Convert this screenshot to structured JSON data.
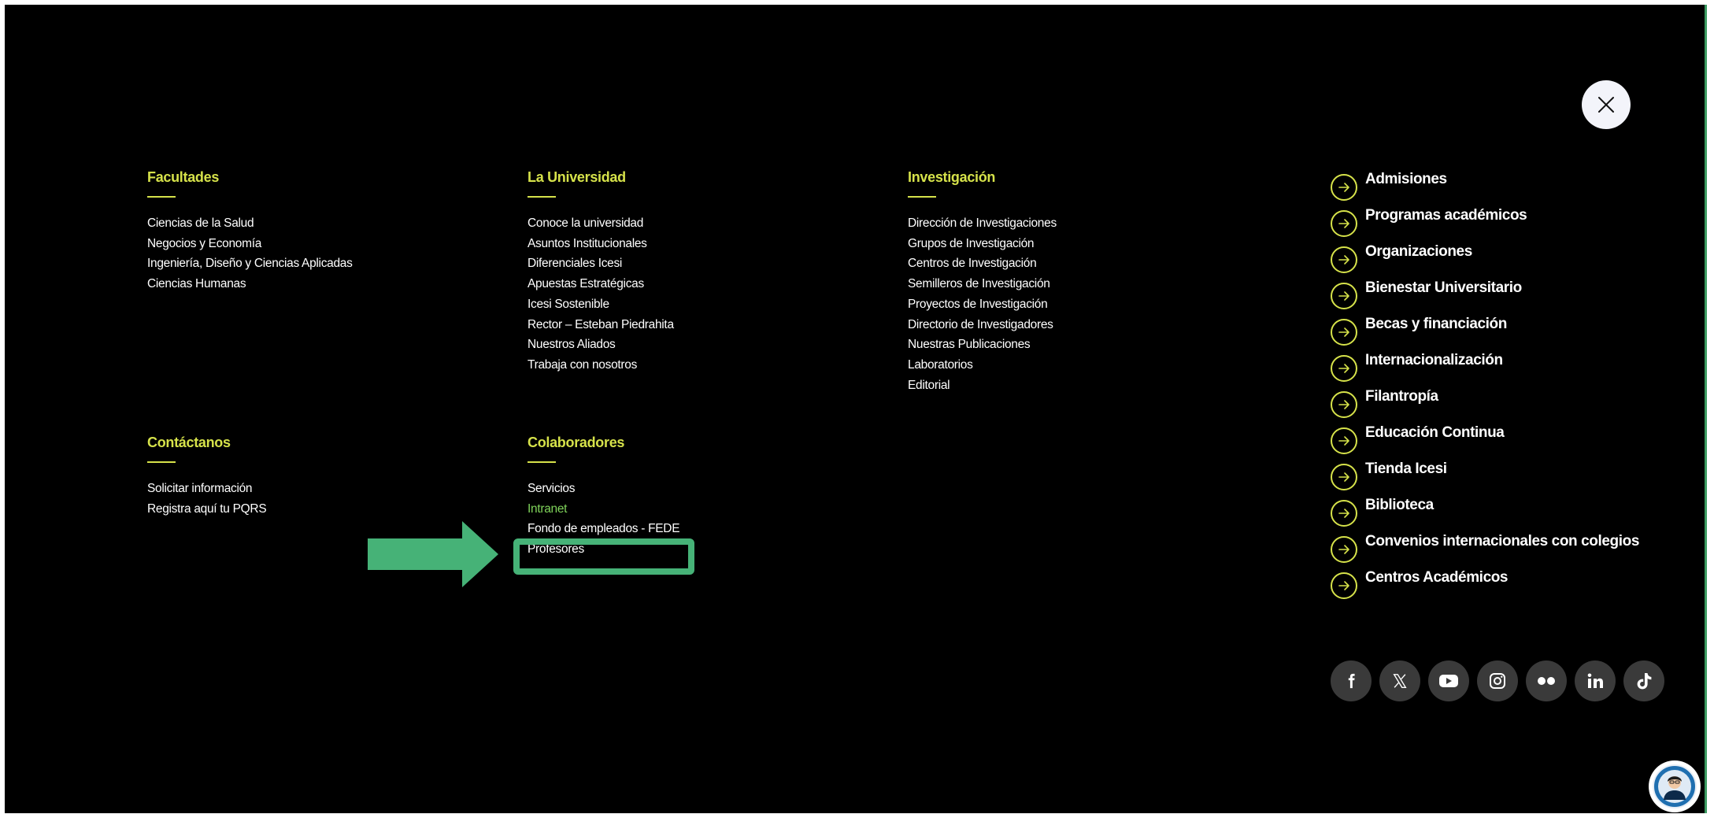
{
  "close": {
    "icon": "close-icon"
  },
  "sections": {
    "facultades": {
      "title": "Facultades",
      "items": [
        "Ciencias de la Salud",
        "Negocios y Economía",
        "Ingeniería, Diseño y Ciencias Aplicadas",
        "Ciencias Humanas"
      ]
    },
    "universidad": {
      "title": "La Universidad",
      "items": [
        "Conoce la universidad",
        "Asuntos Institucionales",
        "Diferenciales Icesi",
        "Apuestas Estratégicas",
        "Icesi Sostenible",
        "Rector – Esteban Piedrahita",
        "Nuestros Aliados",
        "Trabaja con nosotros"
      ]
    },
    "investigacion": {
      "title": "Investigación",
      "items": [
        "Dirección de Investigaciones",
        "Grupos de Investigación",
        "Centros de Investigación",
        "Semilleros de Investigación",
        "Proyectos de Investigación",
        "Directorio de Investigadores",
        "Nuestras Publicaciones",
        "Laboratorios",
        "Editorial"
      ]
    },
    "contactanos": {
      "title": "Contáctanos",
      "items": [
        "Solicitar información",
        "Registra aquí tu PQRS"
      ]
    },
    "colaboradores": {
      "title": "Colaboradores",
      "items": [
        "Servicios",
        "Intranet",
        "Fondo de empleados - FEDE",
        "Profesores"
      ]
    }
  },
  "quick_links": {
    "icon": "arrow-right-circle-icon",
    "items": [
      "Admisiones",
      "Programas académicos",
      "Organizaciones",
      "Bienestar Universitario",
      "Becas y financiación",
      "Internacionalización",
      "Filantropía",
      "Educación Continua",
      "Tienda Icesi",
      "Biblioteca",
      "Convenios internacionales con colegios",
      "Centros Académicos"
    ]
  },
  "social_icons": [
    "facebook-icon",
    "x-icon",
    "youtube-icon",
    "instagram-icon",
    "flickr-icon",
    "linkedin-icon",
    "tiktok-icon"
  ],
  "colors": {
    "background": "#000000",
    "accent_yellow": "#d6e24a",
    "link_green": "#7fd35a",
    "annotation_green": "#46b277",
    "text": "#ffffff"
  }
}
